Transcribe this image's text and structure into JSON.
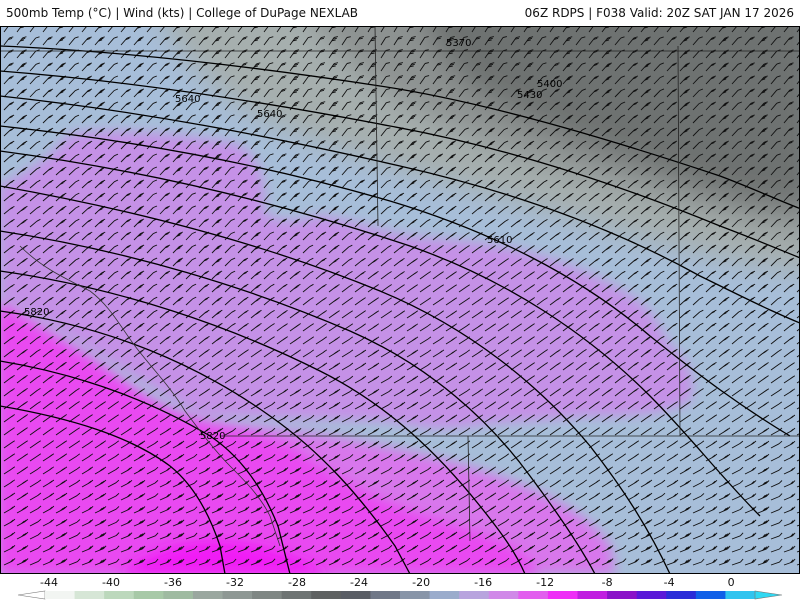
{
  "header": {
    "left_title": "500mb Temp (°C) | Wind (kts) | College of DuPage NEXLAB",
    "right_title": "06Z RDPS | F038 Valid: 20Z SAT JAN 17 2026"
  },
  "contour_labels": [
    "5370",
    "5400",
    "5430",
    "5640",
    "5640",
    "5610",
    "5820",
    "5820"
  ],
  "colorbar": {
    "tick_labels": [
      "-44",
      "-40",
      "-36",
      "-32",
      "-28",
      "-24",
      "-20",
      "-16",
      "-12",
      "-8",
      "-4",
      "0"
    ],
    "colors": [
      "#f2f5f2",
      "#d6e6d6",
      "#bcd8bc",
      "#a7c9a7",
      "#9fbba1",
      "#9aa79f",
      "#8e9894",
      "#7f8784",
      "#6e7473",
      "#5f6262",
      "#5a5e65",
      "#707888",
      "#8895a8",
      "#9aaccc",
      "#b8a4de",
      "#d089e8",
      "#e25fee",
      "#ee2ef6",
      "#c01ee0",
      "#8a12c8",
      "#5a18d8",
      "#2a2cd8",
      "#1060e8",
      "#30c4ef"
    ],
    "arrow_colors": [
      "#ffffff",
      "#30d8f2"
    ]
  },
  "field_colors": {
    "cold_dark": "#6e7271",
    "cold_mid": "#8d9291",
    "gray_light": "#a6afae",
    "blue": "#a7bed9",
    "lavender": "#c591e7",
    "pink": "#d877ec",
    "magenta": "#e94af1",
    "bright_magenta": "#f01df5"
  }
}
